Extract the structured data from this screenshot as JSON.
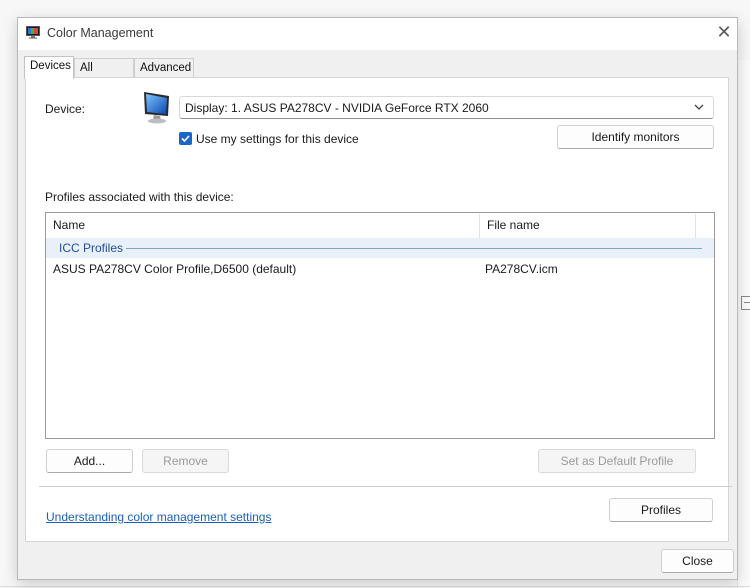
{
  "window": {
    "title": "Color Management",
    "close_icon": "close-icon"
  },
  "tabs": [
    {
      "label": "Devices",
      "active": true
    },
    {
      "label": "All Profiles",
      "active": false
    },
    {
      "label": "Advanced",
      "active": false
    }
  ],
  "device": {
    "label": "Device:",
    "icon": "monitor-icon",
    "selected": "Display: 1. ASUS PA278CV - NVIDIA GeForce RTX 2060",
    "use_settings_label": "Use my settings for this device",
    "use_settings_checked": true,
    "identify_button": "Identify monitors"
  },
  "profiles": {
    "section_label": "Profiles associated with this device:",
    "columns": [
      "Name",
      "File name"
    ],
    "group": "ICC Profiles",
    "rows": [
      {
        "name": "ASUS PA278CV Color Profile,D6500 (default)",
        "file": "PA278CV.icm"
      }
    ],
    "add_button": "Add...",
    "remove_button": "Remove",
    "set_default_button": "Set as Default Profile"
  },
  "footer": {
    "link": "Understanding color management settings",
    "profiles_button": "Profiles",
    "close_button": "Close"
  },
  "colors": {
    "accent": "#1b66c9",
    "link": "#1a5fb4",
    "group_bg": "#e8f0f9"
  }
}
